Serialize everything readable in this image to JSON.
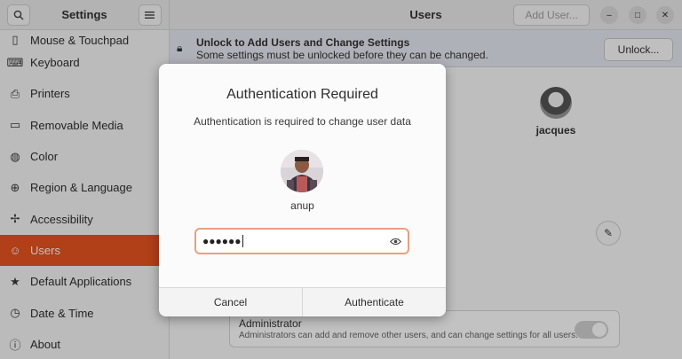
{
  "sidebar": {
    "title": "Settings",
    "search_icon": "search-icon",
    "menu_icon": "hamburger-menu-icon",
    "items": [
      {
        "label": "Mouse & Touchpad",
        "icon": "mouse-icon"
      },
      {
        "label": "Keyboard",
        "icon": "keyboard-icon"
      },
      {
        "label": "Printers",
        "icon": "printer-icon"
      },
      {
        "label": "Removable Media",
        "icon": "removable-media-icon"
      },
      {
        "label": "Color",
        "icon": "color-icon"
      },
      {
        "label": "Region & Language",
        "icon": "globe-icon"
      },
      {
        "label": "Accessibility",
        "icon": "accessibility-icon"
      },
      {
        "label": "Users",
        "icon": "user-icon"
      },
      {
        "label": "Default Applications",
        "icon": "star-icon"
      },
      {
        "label": "Date & Time",
        "icon": "clock-icon"
      },
      {
        "label": "About",
        "icon": "info-icon"
      }
    ],
    "active_item": "Users"
  },
  "header": {
    "title": "Users",
    "add_user_label": "Add User..."
  },
  "unlock_bar": {
    "title": "Unlock to Add Users and Change Settings",
    "subtitle": "Some settings must be unlocked before they can be changed.",
    "button_label": "Unlock..."
  },
  "user_card": {
    "name": "jacques"
  },
  "admin_row": {
    "title": "Administrator",
    "subtitle": "Administrators can add and remove other users, and can change settings for all users."
  },
  "dialog": {
    "title": "Authentication Required",
    "message": "Authentication is required to change user data",
    "username": "anup",
    "password_mask": "●●●●●●",
    "cancel_label": "Cancel",
    "authenticate_label": "Authenticate"
  },
  "colors": {
    "accent": "#e95420",
    "focus_border": "#e9a07e"
  }
}
